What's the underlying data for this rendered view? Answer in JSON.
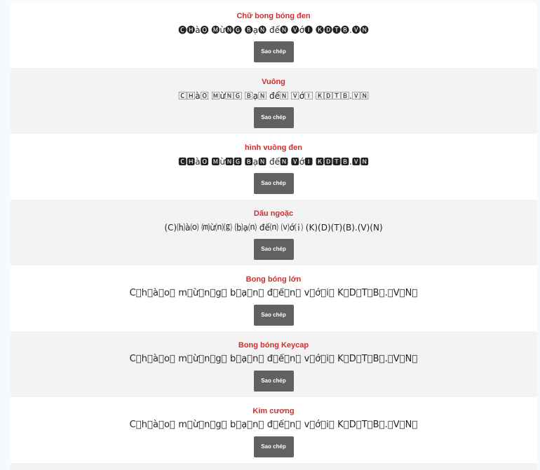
{
  "copy_label": "Sao chép",
  "cards": [
    {
      "title": "Chữ bong bóng đen",
      "text": "🅒🅗à🅞 🅜ừ🅝🅖 🅑ạ🅝 đế🅝 🅥ớ🅘 🅚🅓🅣🅑.🅥🅝",
      "big": false
    },
    {
      "title": "Vuông",
      "text": "🄲🄷à🄾 🄼ừ🄽🄶 🄱ạ🄽 đế🄽 🅅ớ🄸 🄺🄳🅃🄱.🅅🄽",
      "big": false
    },
    {
      "title": "hình vuông đen",
      "text": "🅲🅷à🅾 🅼ừ🅽🅶 🅱ạ🅽 đế🅽 🆅ớ🅸 🅺🅳🆃🅱.🆅🅽",
      "big": false
    },
    {
      "title": "Dấu ngoặc",
      "text": "(C)⒣à⒪ ⒨ừ⒩⒢ ⒝ạ⒩ đế⒩ ⒱ớ⒤ (K)(D)(T)(B).(V)(N)",
      "big": false
    },
    {
      "title": "Bong bóng lớn",
      "text": "C⃝h⃝à⃝o⃝ m⃝ừ⃝n⃝g⃝ b⃝ạ⃝n⃝ đ⃝ế⃝n⃝ v⃝ớ⃝i⃝ K⃝D⃝T⃝B⃝.⃝V⃝N⃝",
      "big": true
    },
    {
      "title": "Bong bóng Keycap",
      "text": "C⃣h⃣à⃣o⃣ m⃣ừ⃣n⃣g⃣ b⃣ạ⃣n⃣ đ⃣ế⃣n⃣ v⃣ớ⃣i⃣ K⃣D⃣T⃣B⃣.⃣V⃣N⃣",
      "big": true
    },
    {
      "title": "Kim cương",
      "text": "C⃟h⃟à⃟o⃟ m⃟ừ⃟n⃟g⃟ b⃟ạ⃟n⃟ đ⃟ế⃟n⃟ v⃟ớ⃟i⃟ K⃟D⃟T⃟B⃟.⃟V⃟N⃟",
      "big": true
    }
  ]
}
